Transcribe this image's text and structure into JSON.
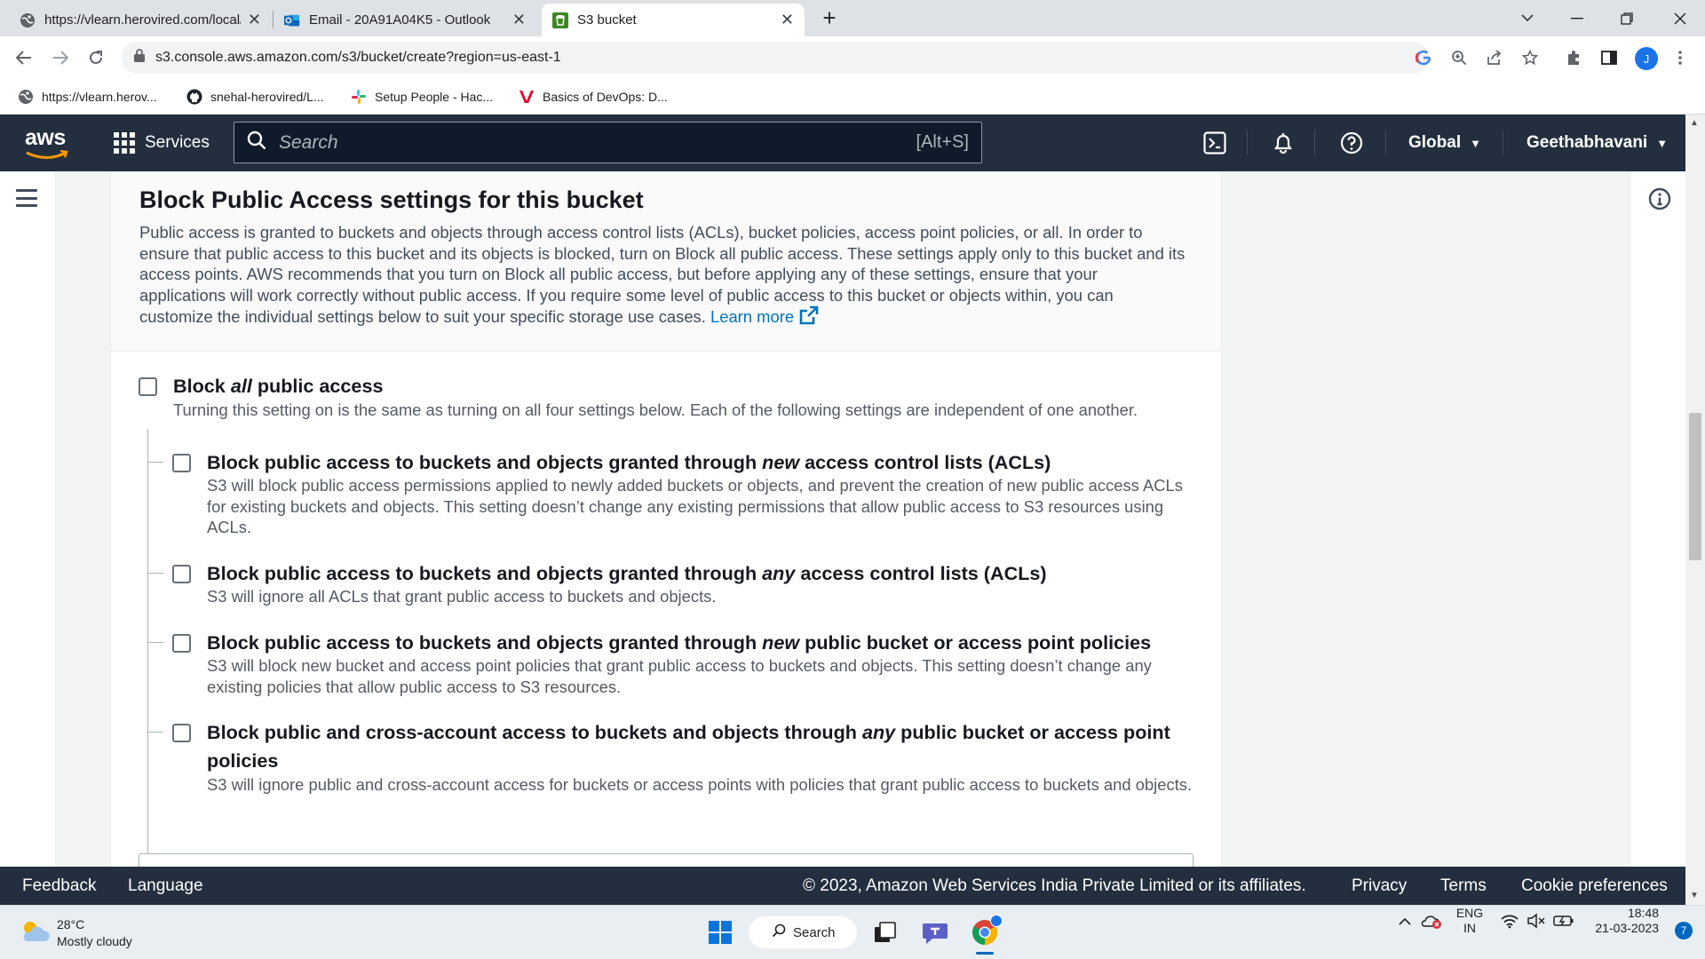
{
  "browser": {
    "tabs": [
      {
        "label": "https://vlearn.herovired.com/local/",
        "icon": "globe-icon"
      },
      {
        "label": "Email - 20A91A04K5 - Outlook",
        "icon": "outlook-icon"
      },
      {
        "label": "S3 bucket",
        "icon": "s3-icon",
        "active": true
      }
    ],
    "address": "s3.console.aws.amazon.com/s3/bucket/create?region=us-east-1",
    "profile_initial": "J",
    "bookmarks": [
      {
        "label": "https://vlearn.herov...",
        "icon": "globe-icon"
      },
      {
        "label": "snehal-herovired/L...",
        "icon": "github-icon"
      },
      {
        "label": "Setup People - Hac...",
        "icon": "slack-icon"
      },
      {
        "label": "Basics of DevOps: D...",
        "icon": "vired-icon"
      }
    ]
  },
  "aws_header": {
    "logo": "aws",
    "services": "Services",
    "search_placeholder": "Search",
    "search_shortcut": "[Alt+S]",
    "region": "Global",
    "account": "Geethabhavani"
  },
  "panel": {
    "title": "Block Public Access settings for this bucket",
    "description": "Public access is granted to buckets and objects through access control lists (ACLs), bucket policies, access point policies, or all. In order to ensure that public access to this bucket and its objects is blocked, turn on Block all public access. These settings apply only to this bucket and its access points. AWS recommends that you turn on Block all public access, but before applying any of these settings, ensure that your applications will work correctly without public access. If you require some level of public access to this bucket or objects within, you can customize the individual settings below to suit your specific storage use cases.",
    "learn_more": "Learn more",
    "block_all": {
      "title_pre": "Block ",
      "title_em": "all",
      "title_post": " public access",
      "desc": "Turning this setting on is the same as turning on all four settings below. Each of the following settings are independent of one another.",
      "checked": false
    },
    "options": [
      {
        "title_pre": "Block public access to buckets and objects granted through ",
        "title_em": "new",
        "title_post": " access control lists (ACLs)",
        "desc": "S3 will block public access permissions applied to newly added buckets or objects, and prevent the creation of new public access ACLs for existing buckets and objects. This setting doesn’t change any existing permissions that allow public access to S3 resources using ACLs.",
        "checked": false
      },
      {
        "title_pre": "Block public access to buckets and objects granted through ",
        "title_em": "any",
        "title_post": " access control lists (ACLs)",
        "desc": "S3 will ignore all ACLs that grant public access to buckets and objects.",
        "checked": false
      },
      {
        "title_pre": "Block public access to buckets and objects granted through ",
        "title_em": "new",
        "title_post": " public bucket or access point policies",
        "desc": "S3 will block new bucket and access point policies that grant public access to buckets and objects. This setting doesn’t change any existing policies that allow public access to S3 resources.",
        "checked": false
      },
      {
        "title_pre": "Block public and cross-account access to buckets and objects through ",
        "title_em": "any",
        "title_post": " public bucket or access point",
        "title_line2": "policies",
        "desc": "S3 will ignore public and cross-account access for buckets or access points with policies that grant public access to buckets and objects.",
        "checked": false
      }
    ]
  },
  "footer": {
    "feedback": "Feedback",
    "language": "Language",
    "copyright": "© 2023, Amazon Web Services India Private Limited or its affiliates.",
    "privacy": "Privacy",
    "terms": "Terms",
    "cookies": "Cookie preferences"
  },
  "taskbar": {
    "weather_temp": "28°C",
    "weather_desc": "Mostly cloudy",
    "search_label": "Search",
    "lang_1": "ENG",
    "lang_2": "IN",
    "time": "18:48",
    "date": "21-03-2023",
    "notifications": "7"
  },
  "colors": {
    "aws_nav": "#232f3e",
    "link": "#0073bb",
    "chrome_tabbar": "#dee1e6"
  }
}
